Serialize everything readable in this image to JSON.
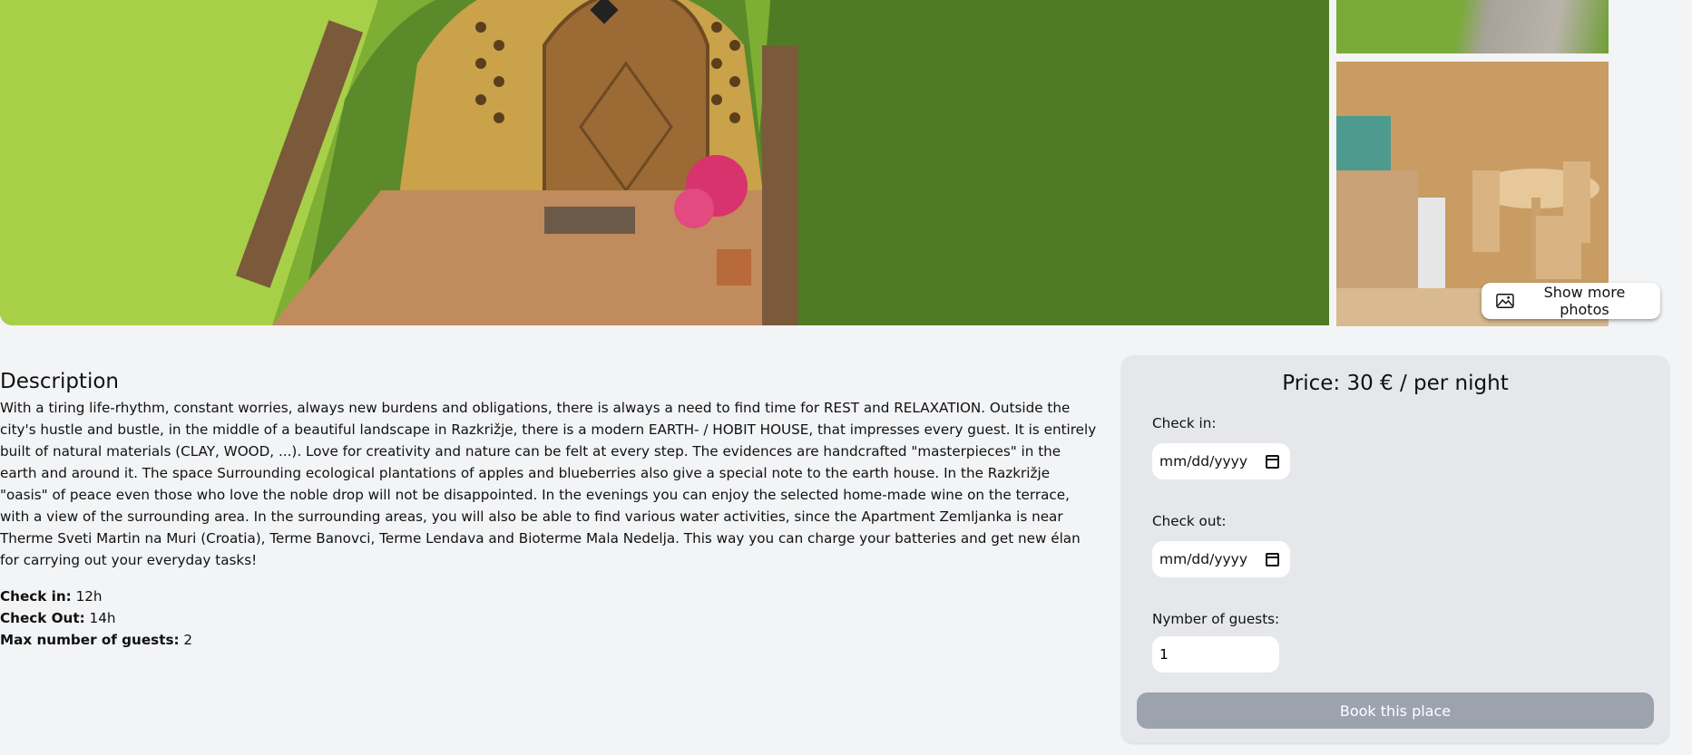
{
  "gallery": {
    "main_photo_alt": "Earth hobbit house entrance",
    "side_photo_1_alt": "Garden path",
    "side_photo_2_alt": "Kitchen interior",
    "show_more_label": "Show more photos",
    "show_more_icon": "image-icon"
  },
  "description": {
    "title": "Description",
    "text": "With a tiring life-rhythm, constant worries, always new burdens and obligations, there is always a need to find time for REST and RELAXATION. Outside the city's hustle and bustle, in the middle of a beautiful landscape in Razkrižje, there is a modern EARTH- / HOBIT HOUSE, that impresses every guest. It is entirely built of natural materials (CLAY, WOOD, ...). Love for creativity and nature can be felt at every step. The evidences are handcrafted \"masterpieces\" in the earth and around it. The space Surrounding ecological plantations of apples and blueberries also give a special note to the earth house. In the Razkrižje \"oasis\" of peace even those who love the noble drop will not be disappointed. In the evenings you can enjoy the selected home-made wine on the terrace, with a view of the surrounding area. In the surrounding areas, you will also be able to find various water activities, since the Apartment Zemljanka is near Therme Sveti Martin na Muri (Croatia), Terme Banovci, Terme Lendava and Bioterme Mala Nedelja. This way you can charge your batteries and get new élan for carrying out your everyday tasks!"
  },
  "facts": {
    "checkin_label": "Check in:",
    "checkin_value": "12h",
    "checkout_label": "Check Out:",
    "checkout_value": "14h",
    "guests_label": "Max number of guests:",
    "guests_value": "2"
  },
  "booking": {
    "price": "Price: 30 € / per night",
    "checkin_label": "Check in:",
    "checkin_placeholder": "mm/dd/yyyy",
    "checkout_label": "Check out:",
    "checkout_placeholder": "mm/dd/yyyy",
    "guests_label": "Nymber of guests:",
    "guests_value": "1",
    "book_label": "Book this place",
    "book_button_color": "#9ca3af"
  }
}
